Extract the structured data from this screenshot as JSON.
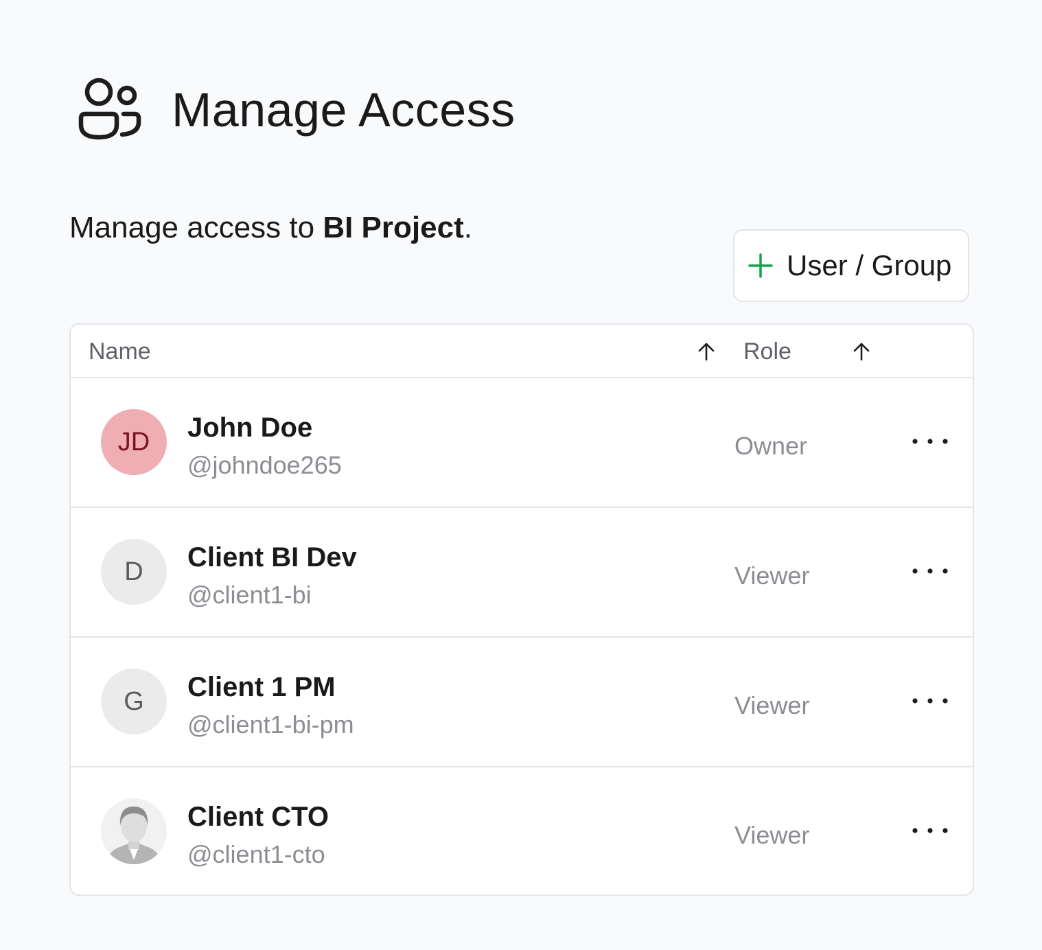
{
  "header": {
    "icon": "people-icon",
    "title": "Manage Access"
  },
  "subtitle": {
    "prefix": "Manage access to ",
    "project": "BI Project",
    "suffix": "."
  },
  "add_button": {
    "icon": "plus-icon",
    "label": "User / Group",
    "accent": "#16a34a"
  },
  "table": {
    "columns": [
      {
        "label": "Name",
        "sort": "ascending"
      },
      {
        "label": "Role",
        "sort": "ascending"
      }
    ],
    "rows": [
      {
        "avatar_type": "initials",
        "initials": "JD",
        "avatar_bg": "#efaeb4",
        "avatar_fg": "#7a1620",
        "name": "John Doe",
        "handle": "@johndoe265",
        "role": "Owner",
        "menu_icon": "more-horizontal-icon"
      },
      {
        "avatar_type": "initials",
        "initials": "D",
        "avatar_bg": "#ebebeb",
        "avatar_fg": "#5b5b5b",
        "name": "Client BI Dev",
        "handle": "@client1-bi",
        "role": "Viewer",
        "menu_icon": "more-horizontal-icon"
      },
      {
        "avatar_type": "initials",
        "initials": "G",
        "avatar_bg": "#ebebeb",
        "avatar_fg": "#5b5b5b",
        "name": "Client 1 PM",
        "handle": "@client1-bi-pm",
        "role": "Viewer",
        "menu_icon": "more-horizontal-icon"
      },
      {
        "avatar_type": "photo",
        "initials": "",
        "name": "Client CTO",
        "handle": "@client1-cto",
        "role": "Viewer",
        "menu_icon": "more-horizontal-icon"
      }
    ]
  }
}
